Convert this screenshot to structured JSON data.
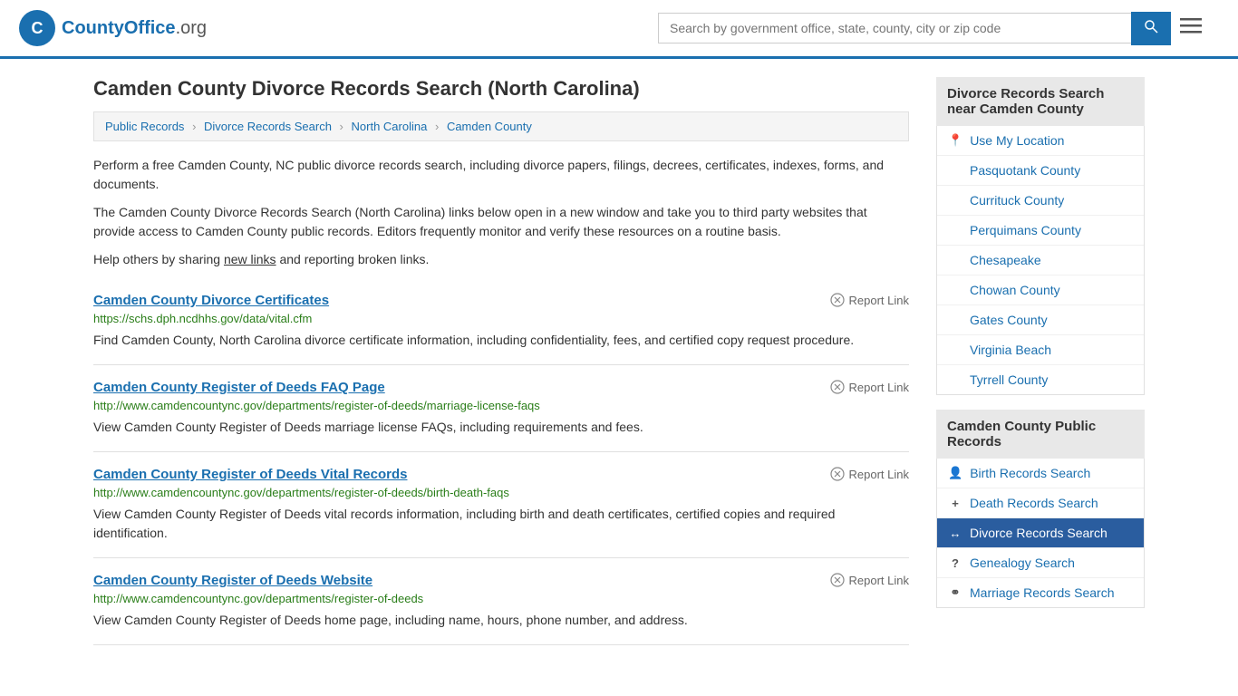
{
  "header": {
    "logo_text": "CountyOffice",
    "logo_suffix": ".org",
    "search_placeholder": "Search by government office, state, county, city or zip code",
    "search_value": ""
  },
  "page": {
    "title": "Camden County Divorce Records Search (North Carolina)",
    "breadcrumb": [
      {
        "label": "Public Records",
        "href": "#"
      },
      {
        "label": "Divorce Records Search",
        "href": "#"
      },
      {
        "label": "North Carolina",
        "href": "#"
      },
      {
        "label": "Camden County",
        "href": "#"
      }
    ],
    "description1": "Perform a free Camden County, NC public divorce records search, including divorce papers, filings, decrees, certificates, indexes, forms, and documents.",
    "description2": "The Camden County Divorce Records Search (North Carolina) links below open in a new window and take you to third party websites that provide access to Camden County public records. Editors frequently monitor and verify these resources on a routine basis.",
    "description3_before": "Help others by sharing ",
    "description3_link": "new links",
    "description3_after": " and reporting broken links."
  },
  "results": [
    {
      "title": "Camden County Divorce Certificates",
      "url": "https://schs.dph.ncdhhs.gov/data/vital.cfm",
      "description": "Find Camden County, North Carolina divorce certificate information, including confidentiality, fees, and certified copy request procedure.",
      "report_label": "Report Link"
    },
    {
      "title": "Camden County Register of Deeds FAQ Page",
      "url": "http://www.camdencountync.gov/departments/register-of-deeds/marriage-license-faqs",
      "description": "View Camden County Register of Deeds marriage license FAQs, including requirements and fees.",
      "report_label": "Report Link"
    },
    {
      "title": "Camden County Register of Deeds Vital Records",
      "url": "http://www.camdencountync.gov/departments/register-of-deeds/birth-death-faqs",
      "description": "View Camden County Register of Deeds vital records information, including birth and death certificates, certified copies and required identification.",
      "report_label": "Report Link"
    },
    {
      "title": "Camden County Register of Deeds Website",
      "url": "http://www.camdencountync.gov/departments/register-of-deeds",
      "description": "View Camden County Register of Deeds home page, including name, hours, phone number, and address.",
      "report_label": "Report Link"
    }
  ],
  "sidebar": {
    "nearby_header": "Divorce Records Search near Camden County",
    "nearby_links": [
      {
        "label": "Use My Location",
        "icon": "location"
      },
      {
        "label": "Pasquotank County",
        "icon": ""
      },
      {
        "label": "Currituck County",
        "icon": ""
      },
      {
        "label": "Perquimans County",
        "icon": ""
      },
      {
        "label": "Chesapeake",
        "icon": ""
      },
      {
        "label": "Chowan County",
        "icon": ""
      },
      {
        "label": "Gates County",
        "icon": ""
      },
      {
        "label": "Virginia Beach",
        "icon": ""
      },
      {
        "label": "Tyrrell County",
        "icon": ""
      }
    ],
    "public_records_header": "Camden County Public Records",
    "public_records_links": [
      {
        "label": "Birth Records Search",
        "icon": "birth",
        "active": false
      },
      {
        "label": "Death Records Search",
        "icon": "death",
        "active": false
      },
      {
        "label": "Divorce Records Search",
        "icon": "divorce",
        "active": true
      },
      {
        "label": "Genealogy Search",
        "icon": "genealogy",
        "active": false
      },
      {
        "label": "Marriage Records Search",
        "icon": "marriage",
        "active": false
      }
    ]
  }
}
